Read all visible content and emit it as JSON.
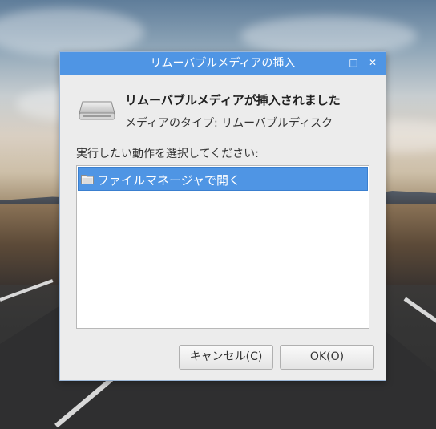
{
  "dialog": {
    "title": "リムーバブルメディアの挿入",
    "heading": "リムーバブルメディアが挿入されました",
    "media_type": "メディアのタイプ:  リムーバブルディスク",
    "prompt": "実行したい動作を選択してください:",
    "actions": [
      {
        "label": "ファイルマネージャで開く",
        "icon": "folder-icon",
        "selected": true
      }
    ],
    "buttons": {
      "cancel": "キャンセル(C)",
      "ok": "OK(O)"
    },
    "window_controls": {
      "minimize": "–",
      "maximize": "□",
      "close": "✕"
    }
  },
  "colors": {
    "titlebar": "#4f95e4",
    "selection": "#4f95e4",
    "dialog_bg": "#ececec"
  }
}
